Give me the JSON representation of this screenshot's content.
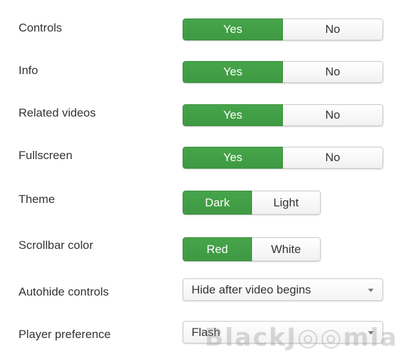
{
  "settings": {
    "controls": {
      "label": "Controls",
      "yes": "Yes",
      "no": "No"
    },
    "info": {
      "label": "Info",
      "yes": "Yes",
      "no": "No"
    },
    "related_videos": {
      "label": "Related videos",
      "yes": "Yes",
      "no": "No"
    },
    "fullscreen": {
      "label": "Fullscreen",
      "yes": "Yes",
      "no": "No"
    },
    "theme": {
      "label": "Theme",
      "dark": "Dark",
      "light": "Light"
    },
    "scrollbar_color": {
      "label": "Scrollbar color",
      "red": "Red",
      "white": "White"
    },
    "autohide_controls": {
      "label": "Autohide controls",
      "value": "Hide after video begins"
    },
    "player_preference": {
      "label": "Player preference",
      "value": "Flash"
    }
  },
  "colors": {
    "active": "#46a44a",
    "inactive": "#ffffff",
    "text": "#333333"
  },
  "watermark": "BlackJ◎◎mla"
}
